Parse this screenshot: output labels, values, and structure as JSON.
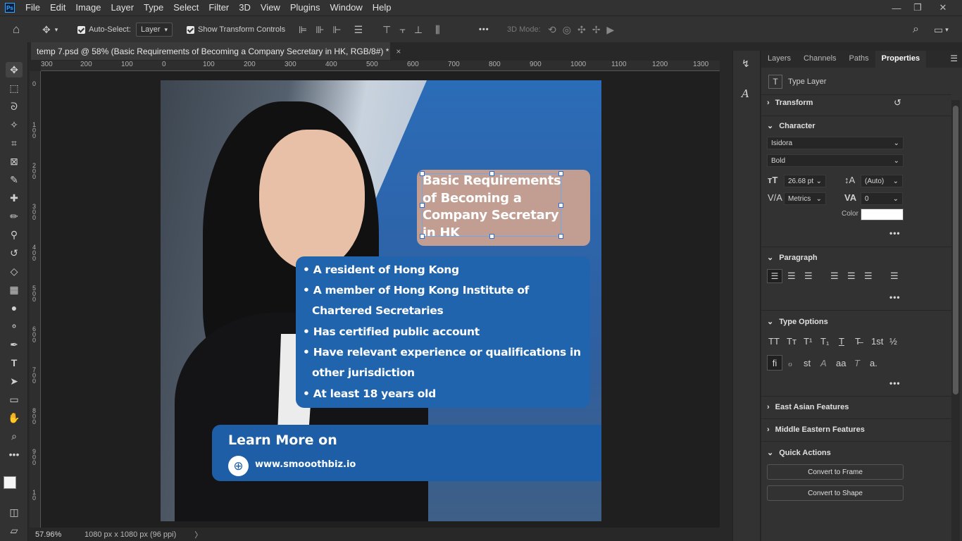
{
  "menubar": {
    "logo": "Ps",
    "items": [
      "File",
      "Edit",
      "Image",
      "Layer",
      "Type",
      "Select",
      "Filter",
      "3D",
      "View",
      "Plugins",
      "Window",
      "Help"
    ],
    "window_controls": [
      "—",
      "❐",
      "✕"
    ]
  },
  "options": {
    "auto_select_label": "Auto-Select:",
    "auto_select_value": "Layer",
    "show_transform_label": "Show Transform Controls",
    "three_d_mode_label": "3D Mode:",
    "more": "•••"
  },
  "tab": {
    "title": "temp 7.psd @ 58% (Basic Requirements of Becoming a Company Secretary  in HK, RGB/8#) *",
    "close": "×"
  },
  "ruler": {
    "h_labels": [
      "300",
      "200",
      "100",
      "0",
      "100",
      "200",
      "300",
      "400",
      "500",
      "600",
      "700",
      "800",
      "900",
      "1000",
      "1100",
      "1200",
      "1300"
    ],
    "v_labels": [
      "0",
      "1 0 0",
      "2 0 0",
      "3 0 0",
      "4 0 0",
      "5 0 0",
      "6 0 0",
      "7 0 0",
      "8 0 0",
      "9 0 0",
      "1 0"
    ]
  },
  "document": {
    "title_lines": [
      "Basic Requirements",
      "of Becoming a",
      "Company Secretary",
      "in HK"
    ],
    "bullets": [
      "• A resident of Hong Kong",
      "• A member of Hong Kong Institute of",
      "Chartered Secretaries",
      "• Has certified public account",
      "• Have relevant experience or qualifications in",
      "other jurisdiction",
      "•  At least 18 years old"
    ],
    "cta_title": "Learn More on",
    "cta_url": "www.smooothbiz.io"
  },
  "status": {
    "zoom": "57.96%",
    "doc_info": "1080 px x 1080 px (96 ppi)",
    "arrow": "〉"
  },
  "panel": {
    "tabs": [
      "Layers",
      "Channels",
      "Paths",
      "Properties"
    ],
    "active_tab": "Properties",
    "layer_kind": "Type Layer",
    "transform": "Transform",
    "character": "Character",
    "font_family": "Isidora",
    "font_style": "Bold",
    "font_size": "26.68 pt",
    "leading": "(Auto)",
    "kerning": "Metrics",
    "tracking": "0",
    "color_label": "Color",
    "text_color": "#ffffff",
    "paragraph": "Paragraph",
    "type_options": "Type Options",
    "east_asian": "East Asian Features",
    "middle_eastern": "Middle Eastern Features",
    "quick_actions": "Quick Actions",
    "convert_frame": "Convert to Frame",
    "convert_shape": "Convert to Shape",
    "more": "•••",
    "type_glyphs_row1": [
      "TT",
      "Tт",
      "T¹",
      "T₁",
      "T",
      "T̶",
      "1st",
      "½"
    ],
    "type_glyphs_row2": [
      "fi",
      "ℴ",
      "st",
      "A",
      "aa",
      "T",
      "a."
    ]
  }
}
